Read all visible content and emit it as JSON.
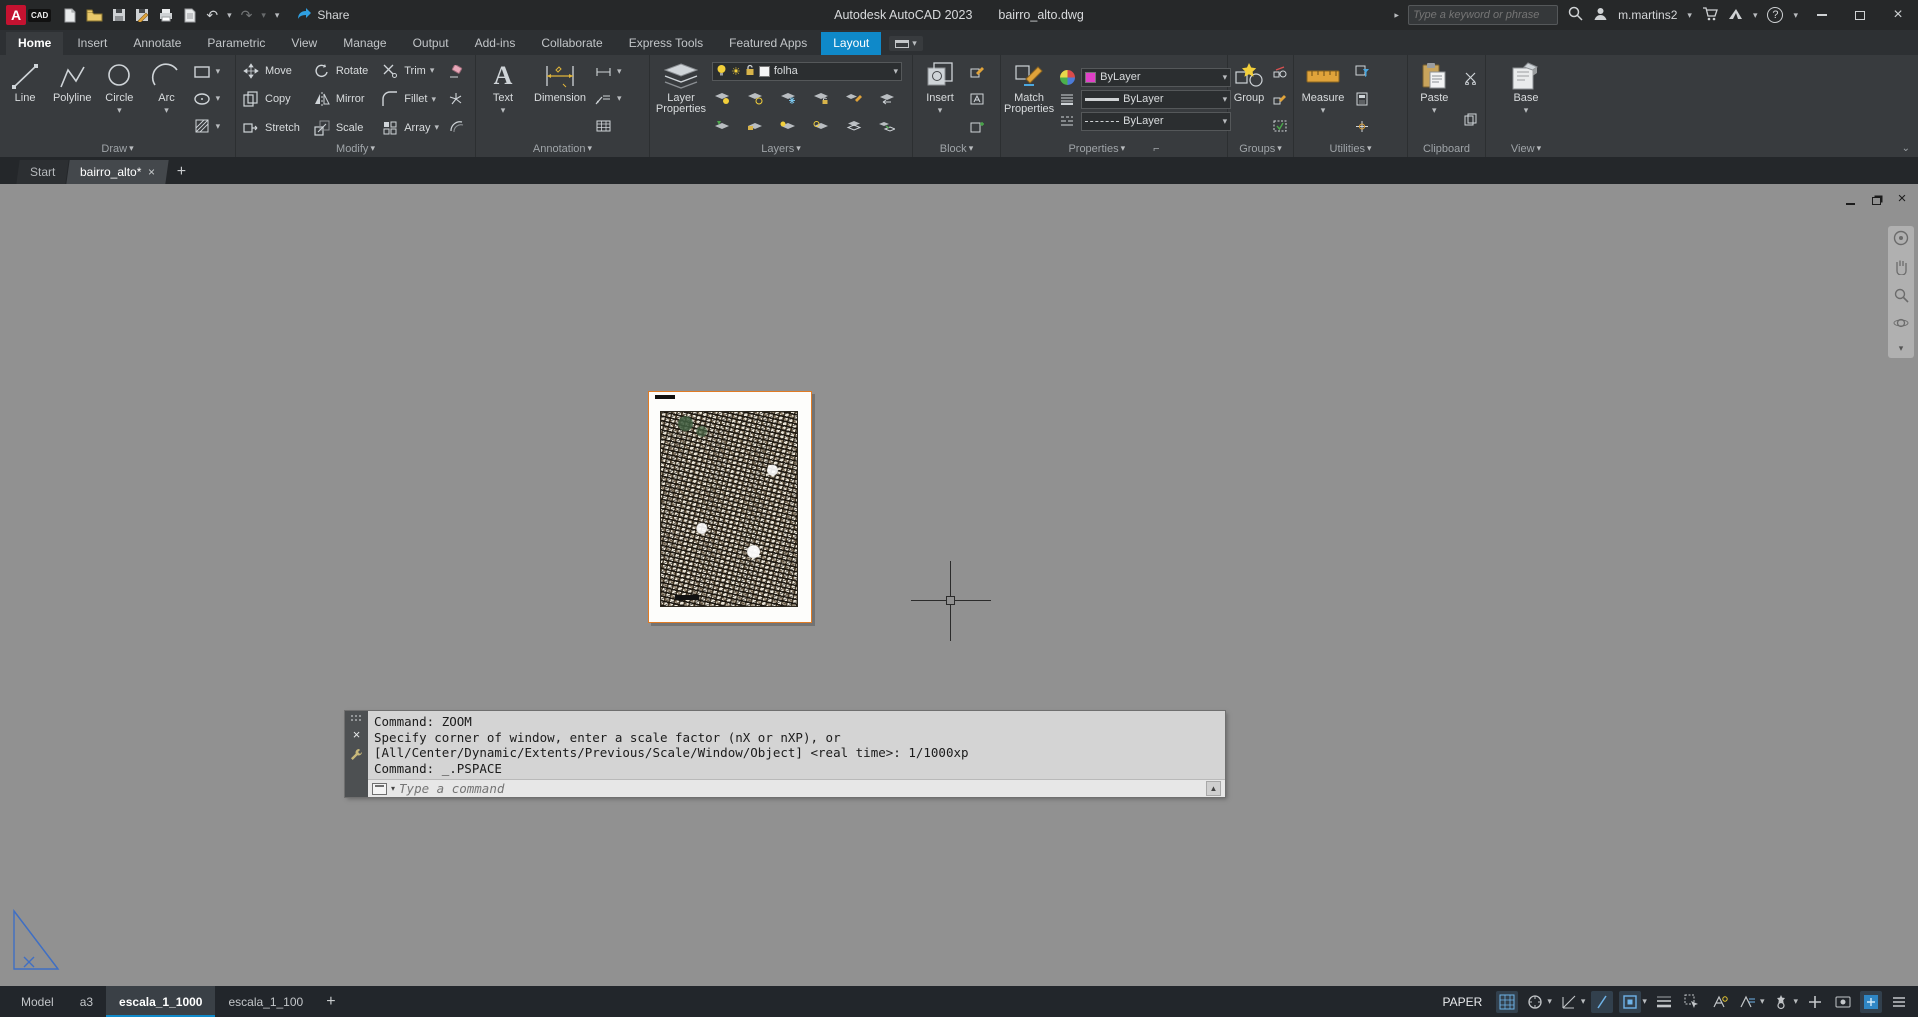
{
  "titlebar": {
    "logo_cad": "CAD",
    "share_label": "Share",
    "app_title": "Autodesk AutoCAD 2023",
    "doc_title": "bairro_alto.dwg",
    "search_placeholder": "Type a keyword or phrase",
    "user_name": "m.martins2"
  },
  "ribbon_tabs": [
    "Home",
    "Insert",
    "Annotate",
    "Parametric",
    "View",
    "Manage",
    "Output",
    "Add-ins",
    "Collaborate",
    "Express Tools",
    "Featured Apps",
    "Layout"
  ],
  "panels": {
    "draw": {
      "label": "Draw",
      "line": "Line",
      "polyline": "Polyline",
      "circle": "Circle",
      "arc": "Arc"
    },
    "modify": {
      "label": "Modify",
      "move": "Move",
      "rotate": "Rotate",
      "trim": "Trim",
      "copy": "Copy",
      "mirror": "Mirror",
      "fillet": "Fillet",
      "stretch": "Stretch",
      "scale": "Scale",
      "array": "Array"
    },
    "annotation": {
      "label": "Annotation",
      "text": "Text",
      "dimension": "Dimension"
    },
    "layers": {
      "label": "Layers",
      "layer_properties": "Layer Properties",
      "current_layer": "folha"
    },
    "block": {
      "label": "Block",
      "insert": "Insert"
    },
    "properties": {
      "label": "Properties",
      "match": "Match Properties",
      "color_value": "ByLayer",
      "lineweight_value": "ByLayer",
      "linetype_value": "ByLayer"
    },
    "groups": {
      "label": "Groups",
      "group": "Group"
    },
    "utilities": {
      "label": "Utilities",
      "measure": "Measure"
    },
    "clipboard": {
      "label": "Clipboard",
      "paste": "Paste"
    },
    "view": {
      "label": "View",
      "base": "Base"
    }
  },
  "file_tabs": {
    "start": "Start",
    "drawing": "bairro_alto*"
  },
  "command": {
    "lines": [
      "Command: ZOOM",
      "Specify corner of window, enter a scale factor (nX or nXP), or",
      "[All/Center/Dynamic/Extents/Previous/Scale/Window/Object] <real time>: 1/1000xp",
      "Command: _.PSPACE"
    ],
    "placeholder": "Type a command"
  },
  "layout_tabs": {
    "model": "Model",
    "a3": "a3",
    "escala_1_1000": "escala_1_1000",
    "escala_1_100": "escala_1_100"
  },
  "statusbar": {
    "space_label": "PAPER"
  }
}
